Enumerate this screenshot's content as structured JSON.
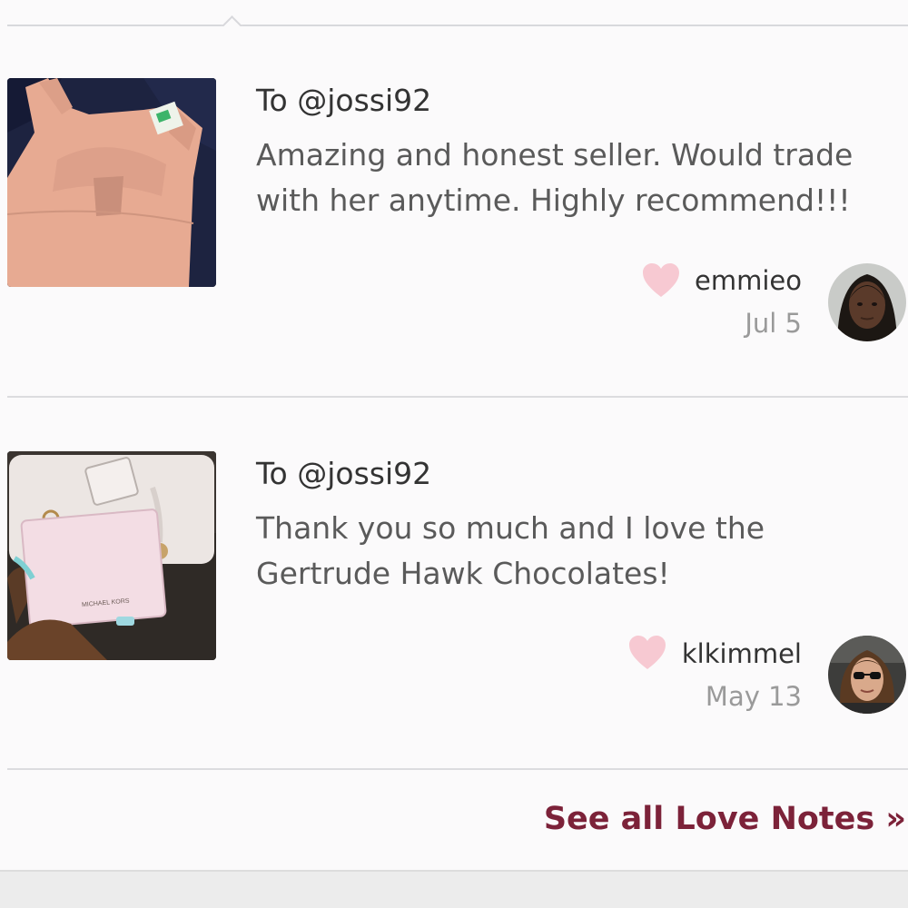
{
  "notes": [
    {
      "recipient": "To @jossi92",
      "message": "Amazing and honest seller. Would trade with her anytime. Highly recommend!!!",
      "author": "emmieo",
      "date": "Jul 5",
      "thumbnail": "pink-dress-photo",
      "avatar": "emmieo-avatar"
    },
    {
      "recipient": "To @jossi92",
      "message": "Thank you so much and I love the Gertrude Hawk Chocolates!",
      "author": "klkimmel",
      "date": "May 13",
      "thumbnail": "michael-kors-wallet-photo",
      "thumbnail_text": "MICHAEL KORS",
      "avatar": "klkimmel-avatar"
    }
  ],
  "footer": {
    "see_all_label": "See all Love Notes »"
  },
  "colors": {
    "accent": "#7c2239",
    "heart": "#f7c9d2",
    "text_primary": "#333333",
    "text_secondary": "#5a5a5a",
    "text_muted": "#9a9a9a"
  }
}
